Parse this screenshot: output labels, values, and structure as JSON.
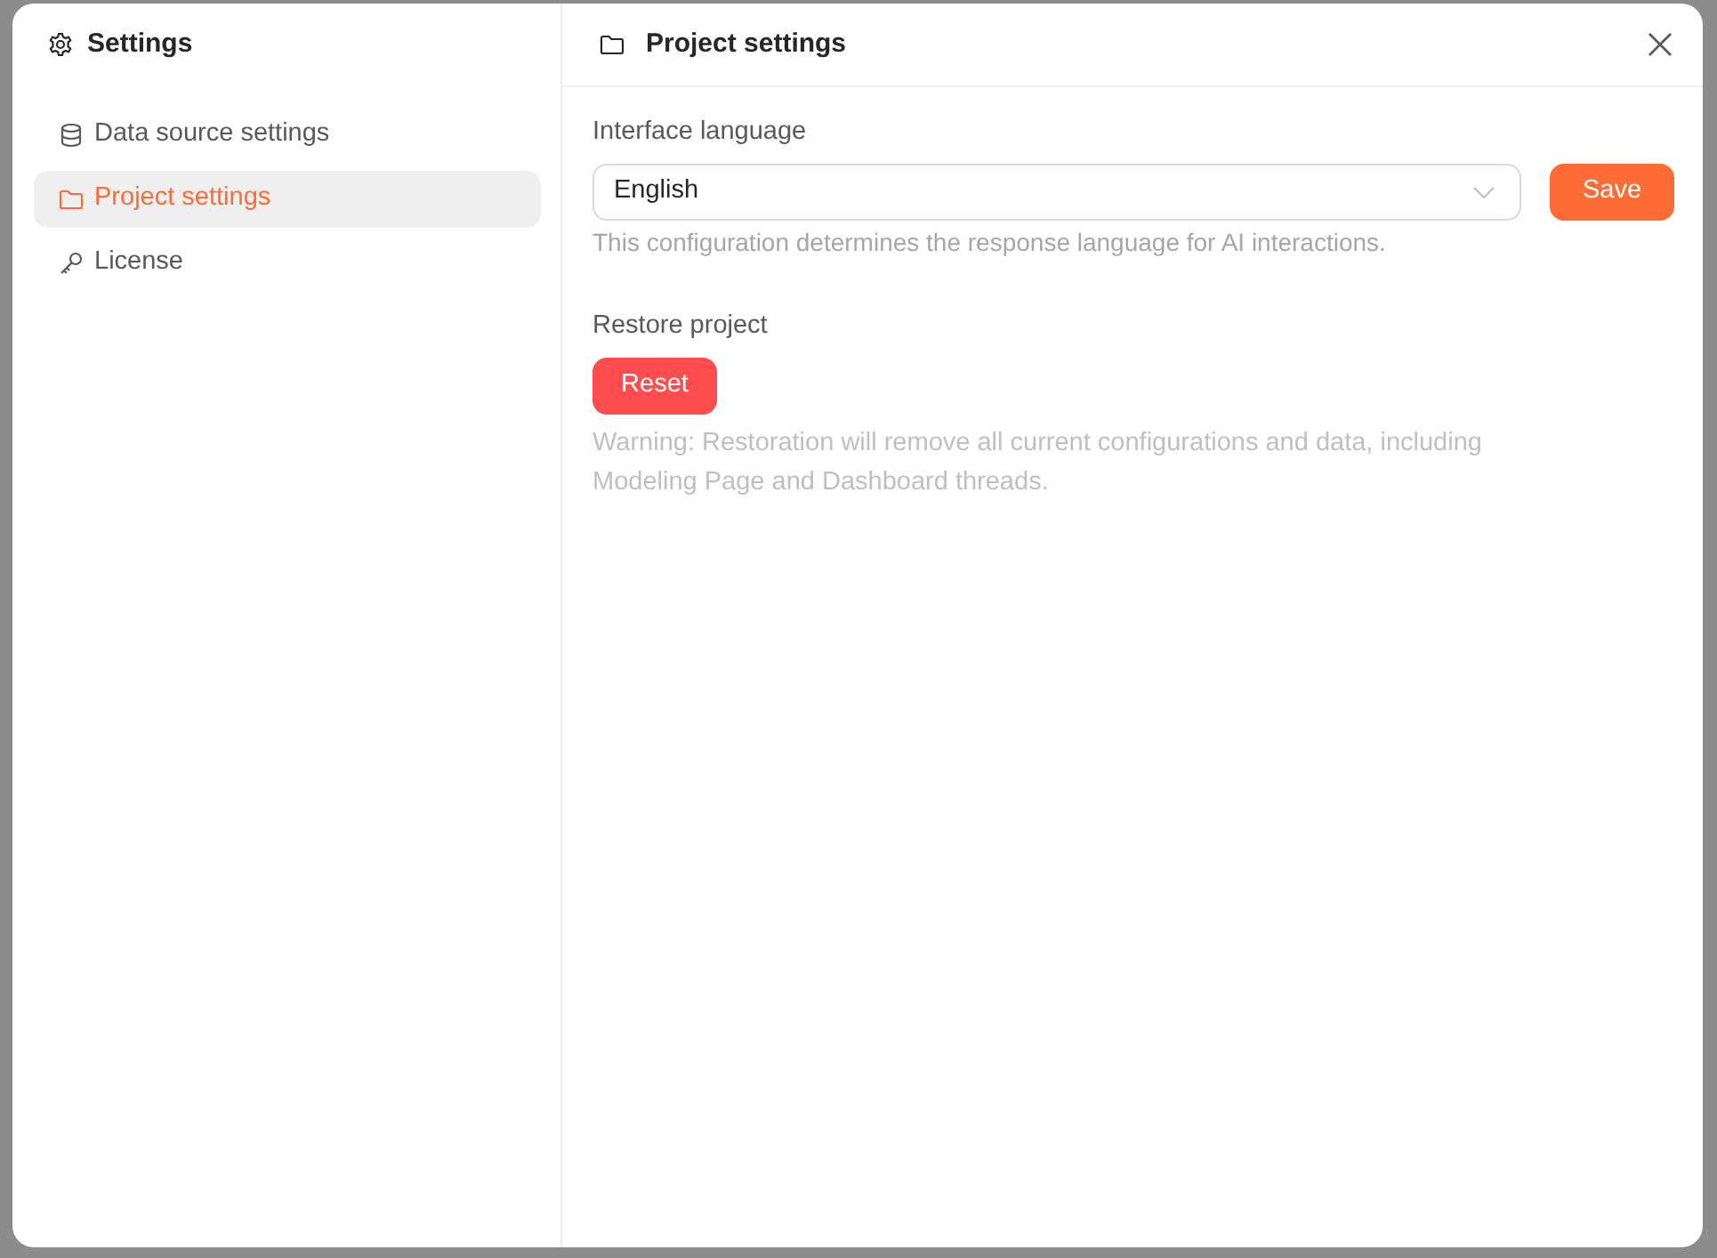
{
  "sidebar": {
    "title": "Settings",
    "items": [
      {
        "kind": "database",
        "label": "Data source settings",
        "selected": false
      },
      {
        "kind": "folder",
        "label": "Project settings",
        "selected": true
      },
      {
        "kind": "key",
        "label": "License",
        "selected": false
      }
    ]
  },
  "panel": {
    "title": "Project settings"
  },
  "language": {
    "label": "Interface language",
    "value": "English",
    "hint": "This configuration determines the response language for AI interactions.",
    "button": "Save"
  },
  "restore": {
    "label": "Restore project",
    "button": "Reset",
    "warning": "Warning: Restoration will remove all current configurations and data, including Modeling Page and Dashboard threads."
  }
}
